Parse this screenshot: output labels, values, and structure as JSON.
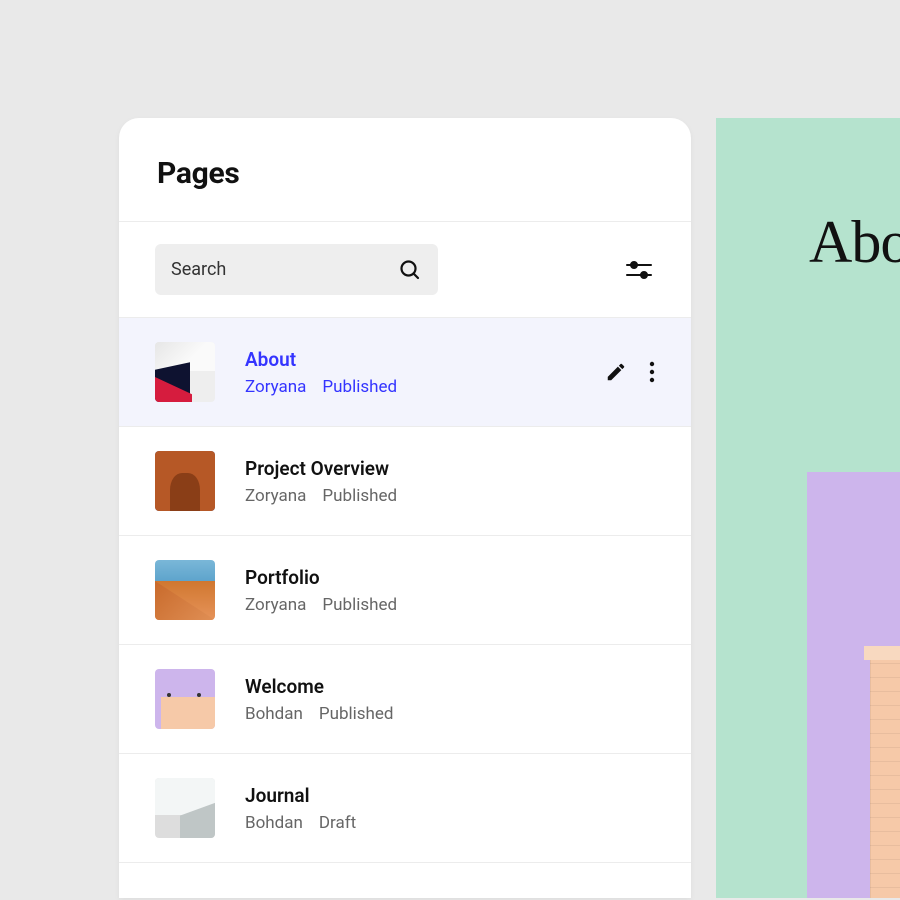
{
  "panel": {
    "title": "Pages"
  },
  "search": {
    "placeholder": "Search"
  },
  "preview": {
    "title": "About"
  },
  "pages": [
    {
      "title": "About",
      "author": "Zoryana",
      "status": "Published",
      "selected": true,
      "thumb": "t1"
    },
    {
      "title": "Project Overview",
      "author": "Zoryana",
      "status": "Published",
      "selected": false,
      "thumb": "t2"
    },
    {
      "title": "Portfolio",
      "author": "Zoryana",
      "status": "Published",
      "selected": false,
      "thumb": "t3"
    },
    {
      "title": "Welcome",
      "author": "Bohdan",
      "status": "Published",
      "selected": false,
      "thumb": "t4"
    },
    {
      "title": "Journal",
      "author": "Bohdan",
      "status": "Draft",
      "selected": false,
      "thumb": "t5"
    }
  ]
}
